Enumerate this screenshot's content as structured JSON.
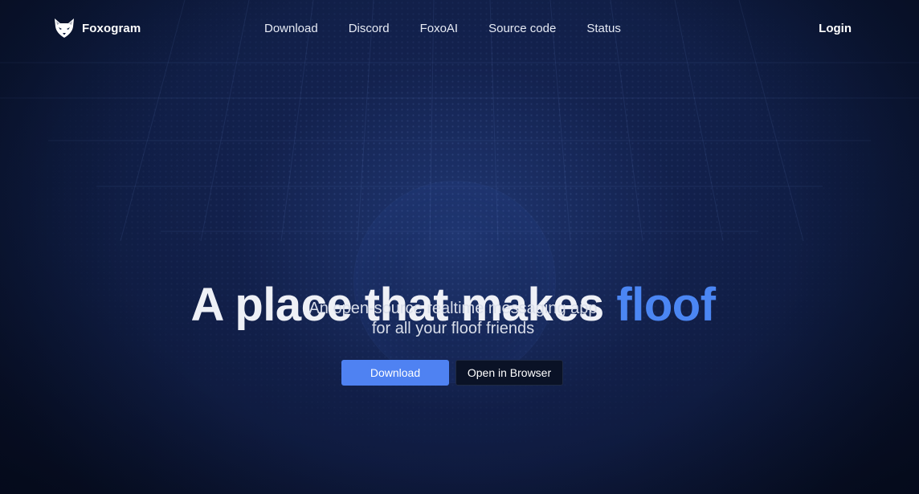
{
  "nav": {
    "brand": "Foxogram",
    "links": [
      "Download",
      "Discord",
      "FoxoAI",
      "Source code",
      "Status"
    ],
    "login": "Login"
  },
  "hero": {
    "title_main": "A place that makes ",
    "title_accent": "floof",
    "subtitle_line1": "An open-source realtime messaging app",
    "subtitle_line2": "for all your floof friends",
    "primary_button": "Download",
    "secondary_button": "Open in Browser"
  },
  "colors": {
    "accent": "#4b86f3",
    "button_primary": "#4f82f2",
    "background": "#0a1430"
  },
  "icons": {
    "brand_logo": "fox-logo-icon"
  }
}
